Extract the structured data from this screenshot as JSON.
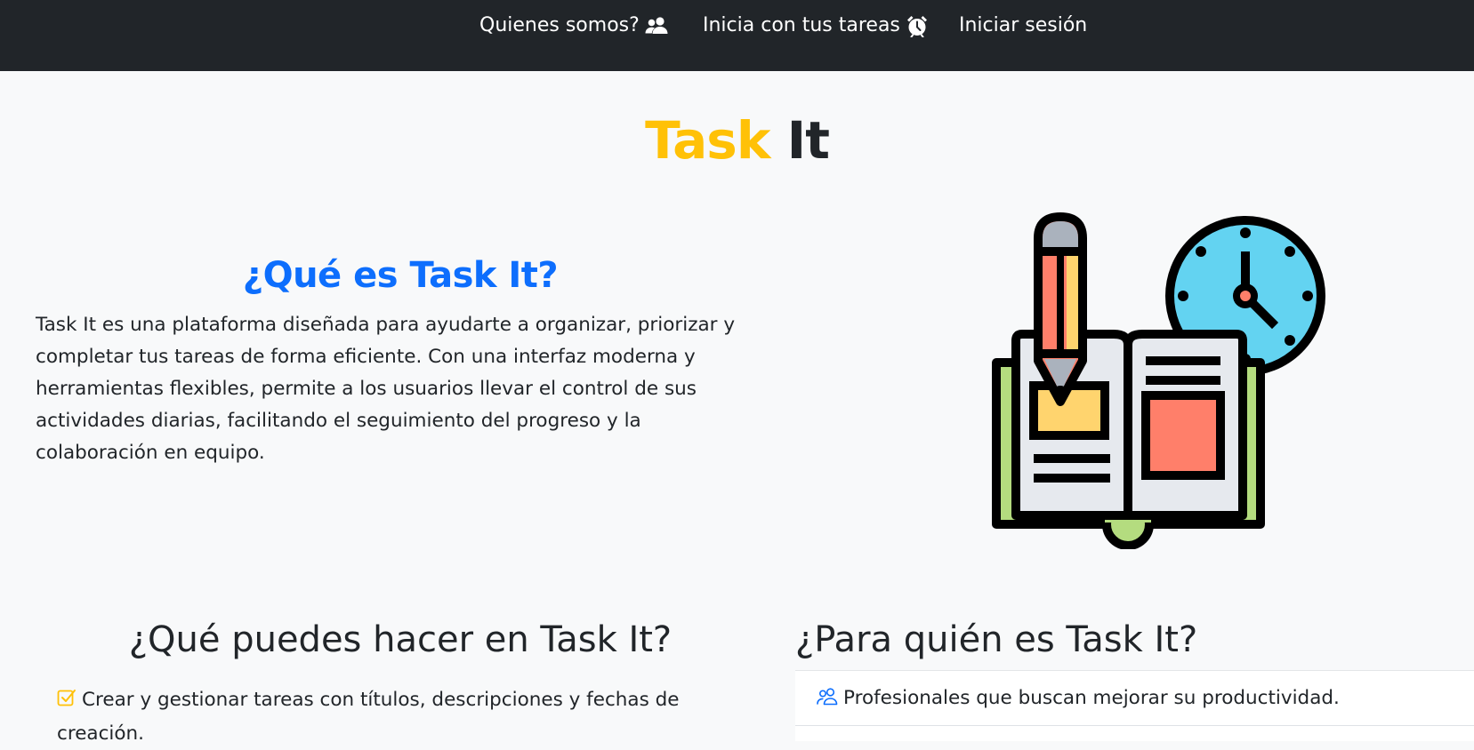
{
  "nav": {
    "about_label": "Quienes somos?",
    "about_icon": "people-fill-icon",
    "start_label": "Inicia con tus tareas",
    "start_icon": "alarm-clock-icon",
    "login_label": "Iniciar sesión"
  },
  "brand": {
    "word1": "Task",
    "word2": "It"
  },
  "about": {
    "heading": "¿Qué es Task It?",
    "text": "Task It es una plataforma diseñada para ayudarte a organizar, priorizar y completar tus tareas de forma eficiente. Con una interfaz moderna y herramientas flexibles, permite a los usuarios llevar el control de sus actividades diarias, facilitando el seguimiento del progreso y la colaboración en equipo."
  },
  "illustration": {
    "icon": "notebook-pencil-clock-illustration"
  },
  "features": {
    "heading": "¿Qué puedes hacer en Task It?",
    "items": [
      "Crear y gestionar tareas con títulos, descripciones y fechas de creación."
    ],
    "item_icon": "check-square-icon"
  },
  "audience": {
    "heading": "¿Para quién es Task It?",
    "items": [
      "Profesionales que buscan mejorar su productividad."
    ],
    "item_icon": "people-icon"
  },
  "colors": {
    "navbar_bg": "#212529",
    "brand_yellow": "#ffc107",
    "primary_blue": "#0d6efd",
    "page_bg": "#f8f9fa"
  }
}
